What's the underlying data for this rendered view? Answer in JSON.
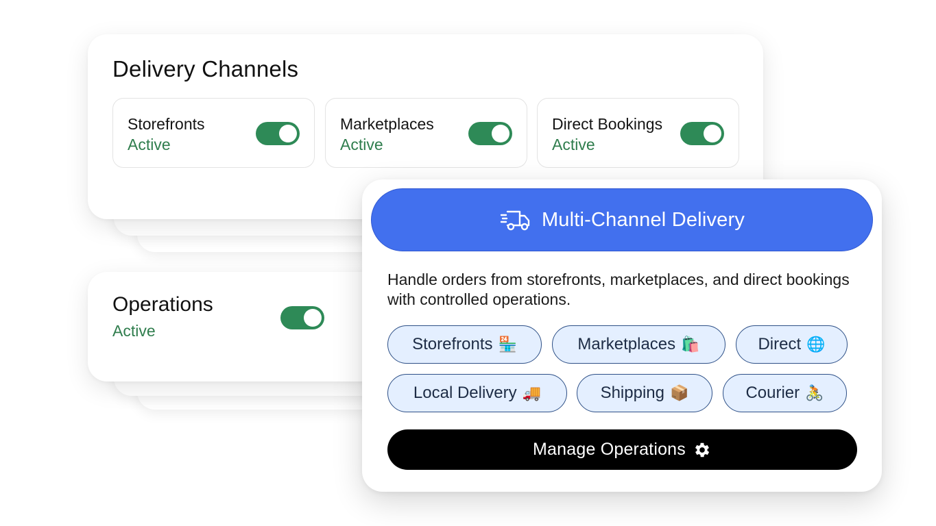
{
  "channels_card": {
    "title": "Delivery Channels",
    "tiles": [
      {
        "name": "Storefronts",
        "status": "Active",
        "enabled": true
      },
      {
        "name": "Marketplaces",
        "status": "Active",
        "enabled": true
      },
      {
        "name": "Direct Bookings",
        "status": "Active",
        "enabled": true
      }
    ]
  },
  "operations_card": {
    "title": "Operations",
    "status": "Active",
    "enabled": true
  },
  "popup": {
    "header_icon": "delivery-truck-icon",
    "title": "Multi-Channel Delivery",
    "description": "Handle orders from storefronts, marketplaces, and direct bookings with controlled operations.",
    "chips": [
      {
        "label": "Storefronts",
        "emoji": "🏪"
      },
      {
        "label": "Marketplaces",
        "emoji": "🛍️"
      },
      {
        "label": "Direct",
        "emoji": "🌐"
      },
      {
        "label": "Local Delivery",
        "emoji": "🚚"
      },
      {
        "label": "Shipping",
        "emoji": "📦"
      },
      {
        "label": "Courier",
        "emoji": "🚴"
      }
    ],
    "action_label": "Manage Operations",
    "action_icon": "gear-icon"
  },
  "colors": {
    "accent_blue": "#4270ee",
    "active_green": "#2e8a57",
    "status_text_green": "#2f7d4d",
    "chip_fill": "#e4efff",
    "chip_border": "#2d4f86",
    "button_black": "#000000"
  }
}
